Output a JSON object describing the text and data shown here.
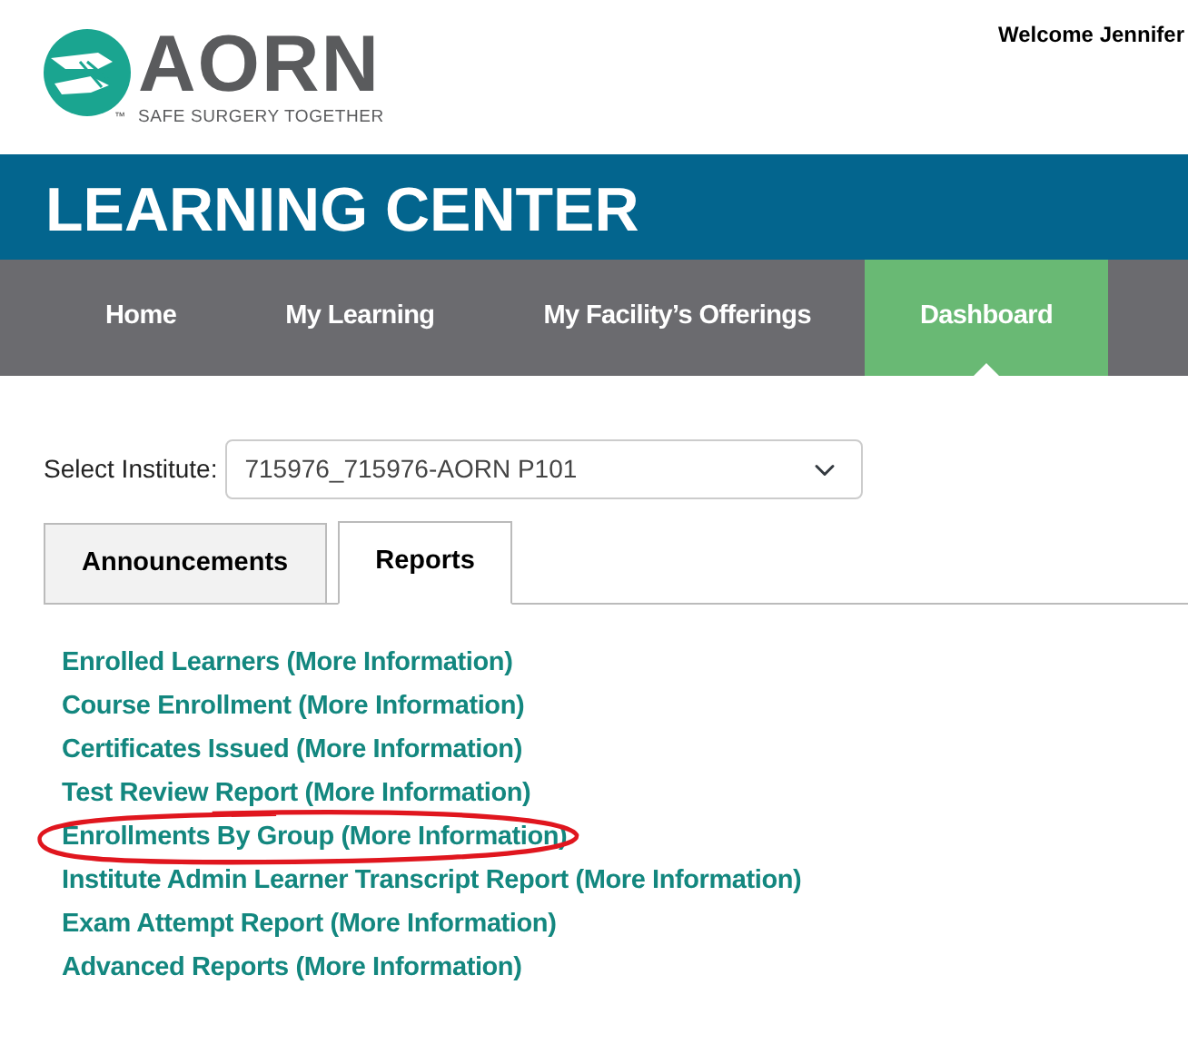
{
  "logo": {
    "name": "AORN",
    "tagline": "SAFE SURGERY TOGETHER",
    "trademark": "™"
  },
  "welcome": {
    "greeting": "Welcome",
    "user": "Jennifer"
  },
  "banner": {
    "title": "LEARNING CENTER"
  },
  "nav": [
    {
      "label": "Home",
      "selected": false
    },
    {
      "label": "My Learning",
      "selected": false
    },
    {
      "label": "My Facility’s Offerings",
      "selected": false
    },
    {
      "label": "Dashboard",
      "selected": true
    }
  ],
  "institute": {
    "label": "Select Institute:",
    "value": "715976_715976-AORN P101"
  },
  "tabs": [
    {
      "label": "Announcements",
      "selected": false
    },
    {
      "label": "Reports",
      "selected": true
    }
  ],
  "reports": [
    {
      "label": "Enrolled Learners",
      "more": "(More Information)",
      "circled": false
    },
    {
      "label": "Course Enrollment",
      "more": "(More Information)",
      "circled": false
    },
    {
      "label": "Certificates Issued",
      "more": "(More Information)",
      "circled": false
    },
    {
      "label": "Test Review Report",
      "more": "(More Information)",
      "circled": false
    },
    {
      "label": "Enrollments By Group",
      "more": "(More Information)",
      "circled": true
    },
    {
      "label": "Institute Admin Learner Transcript Report",
      "more": "(More Information)",
      "circled": false
    },
    {
      "label": "Exam Attempt Report",
      "more": "(More Information)",
      "circled": false
    },
    {
      "label": "Advanced Reports",
      "more": "(More Information)",
      "circled": false
    }
  ]
}
